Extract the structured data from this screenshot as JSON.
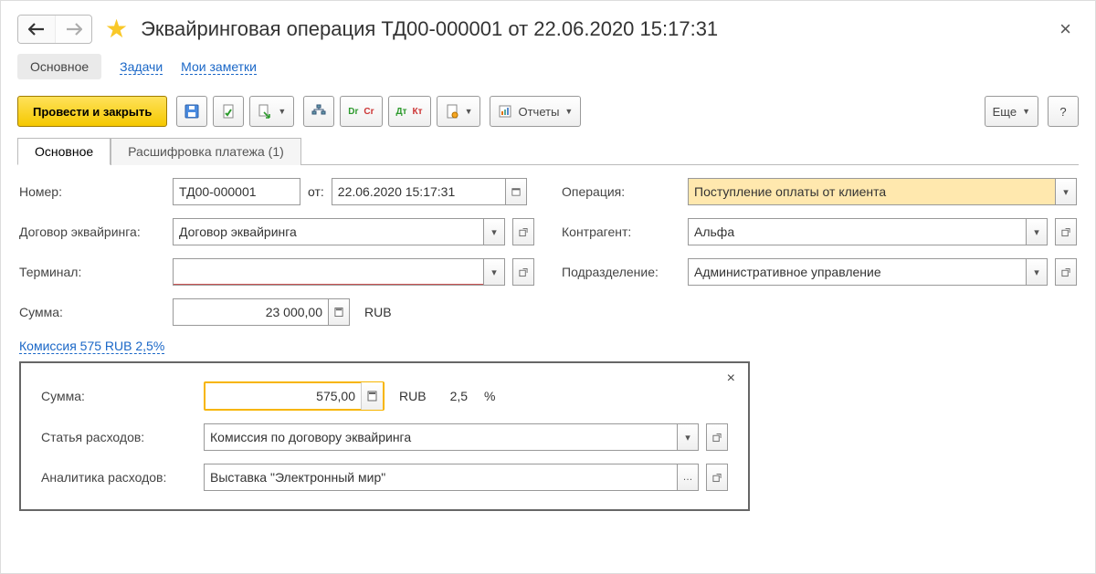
{
  "title": "Эквайринговая операция ТД00-000001 от 22.06.2020 15:17:31",
  "subnav": {
    "main": "Основное",
    "tasks": "Задачи",
    "notes": "Мои заметки"
  },
  "toolbar": {
    "post_close": "Провести и закрыть",
    "reports": "Отчеты",
    "more": "Еще"
  },
  "tabs": {
    "main": "Основное",
    "detail": "Расшифровка платежа (1)"
  },
  "labels": {
    "number": "Номер:",
    "from": "от:",
    "contract": "Договор эквайринга:",
    "terminal": "Терминал:",
    "amount": "Сумма:",
    "operation": "Операция:",
    "counterparty": "Контрагент:",
    "department": "Подразделение:",
    "commission_link": "Комиссия 575 RUB 2,5%",
    "det_amount": "Сумма:",
    "det_expense": "Статья расходов:",
    "det_analytics": "Аналитика расходов:"
  },
  "values": {
    "number": "ТД00-000001",
    "date": "22.06.2020 15:17:31",
    "contract": "Договор эквайринга",
    "terminal": "",
    "amount": "23 000,00",
    "currency": "RUB",
    "operation": "Поступление оплаты от клиента",
    "counterparty": "Альфа",
    "department": "Административное управление",
    "det_amount": "575,00",
    "det_currency": "RUB",
    "det_pct_val": "2,5",
    "det_pct_sign": "%",
    "det_expense": "Комиссия по договору эквайринга",
    "det_analytics": "Выставка \"Электронный мир\""
  }
}
